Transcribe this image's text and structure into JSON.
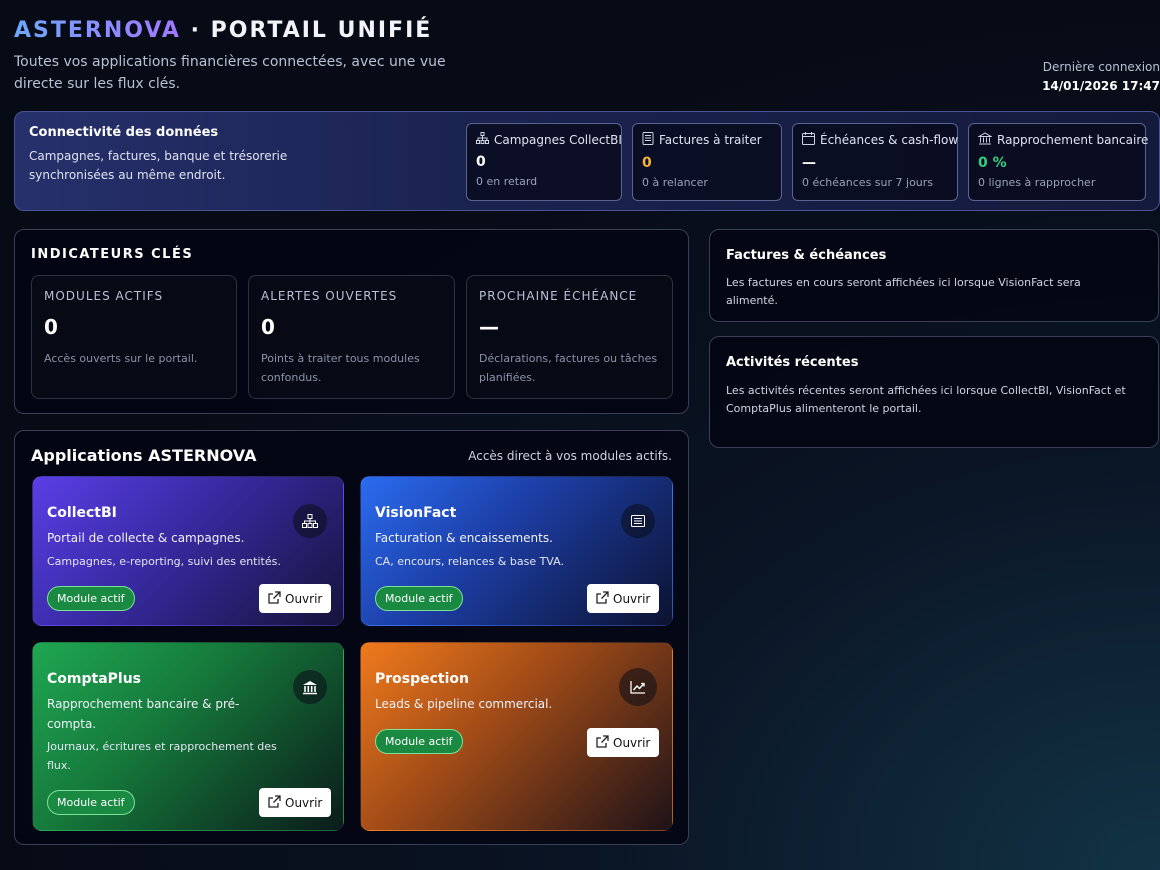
{
  "header": {
    "brand_primary": "ASTERNOVA",
    "brand_separator": " · ",
    "brand_secondary": "PORTAIL UNIFIÉ",
    "subtitle": "Toutes vos applications financières connectées, avec une vue directe sur les flux clés.",
    "last_login_label": "Dernière connexion",
    "last_login_value": "14/01/2026 17:47"
  },
  "connectivity": {
    "title": "Connectivité des données",
    "description": "Campagnes, factures, banque et trésorerie synchronisées au même endroit.",
    "cards": [
      {
        "icon": "sitemap-icon",
        "label": "Campagnes CollectBI",
        "value": "0",
        "sub": "0 en retard",
        "color": "#ffffff"
      },
      {
        "icon": "invoice-icon",
        "label": "Factures à traiter",
        "value": "0",
        "sub": "0 à relancer",
        "color": "#f4b338"
      },
      {
        "icon": "calendar-icon",
        "label": "Échéances & cash-flow",
        "value": "—",
        "sub": "0 échéances sur 7 jours",
        "color": "#ffffff"
      },
      {
        "icon": "bank-icon",
        "label": "Rapprochement bancaire",
        "value": "0 %",
        "sub": "0 lignes à rapprocher",
        "color": "#35d07f"
      }
    ]
  },
  "kpis": {
    "title": "INDICATEURS CLÉS",
    "cards": [
      {
        "label": "MODULES ACTIFS",
        "value": "0",
        "sub": "Accès ouverts sur le portail."
      },
      {
        "label": "ALERTES OUVERTES",
        "value": "0",
        "sub": "Points à traiter tous modules confondus."
      },
      {
        "label": "PROCHAINE ÉCHÉANCE",
        "value": "—",
        "sub": "Déclarations, factures ou tâches planifiées."
      }
    ]
  },
  "apps": {
    "title": "Applications ASTERNOVA",
    "subtitle": "Accès direct à vos modules actifs.",
    "badge_label": "Module actif",
    "open_label": "Ouvrir",
    "items": [
      {
        "name": "CollectBI",
        "tagline": "Portail de collecte & campagnes.",
        "description": "Campagnes, e-reporting, suivi des entités.",
        "icon": "sitemap-icon"
      },
      {
        "name": "VisionFact",
        "tagline": "Facturation & encaissements.",
        "description": "CA, encours, relances & base TVA.",
        "icon": "invoice-icon"
      },
      {
        "name": "ComptaPlus",
        "tagline": "Rapprochement bancaire & pré-compta.",
        "description": "Journaux, écritures et rapprochement des flux.",
        "icon": "bank-icon"
      },
      {
        "name": "Prospection",
        "tagline": "Leads & pipeline commercial.",
        "description": "",
        "icon": "trend-chart-icon"
      }
    ]
  },
  "invoices_panel": {
    "title": "Factures & échéances",
    "text": "Les factures en cours seront affichées ici lorsque VisionFact sera alimenté."
  },
  "activity_panel": {
    "title": "Activités récentes",
    "text": "Les activités récentes seront affichées ici lorsque CollectBI, VisionFact et ComptaPlus alimenteront le portail."
  }
}
